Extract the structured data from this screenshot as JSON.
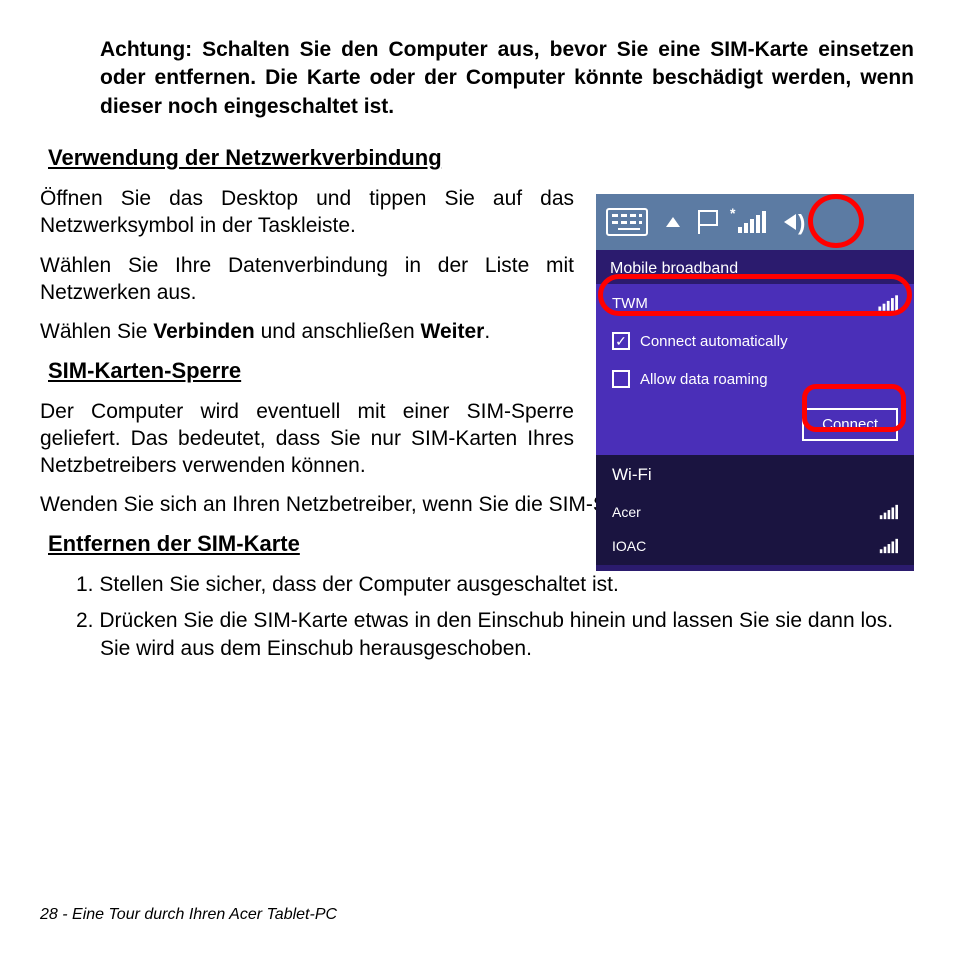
{
  "warning": "Achtung: Schalten Sie den Computer aus, bevor Sie eine SIM-Karte einsetzen oder entfernen. Die Karte oder der Computer könnte beschädigt werden, wenn dieser noch eingeschaltet ist.",
  "section1": {
    "heading": "Verwendung der Netzwerkverbindung",
    "p1": "Öffnen Sie das Desktop und tippen Sie auf das Netzwerksymbol in der Taskleiste.",
    "p2": "Wählen Sie Ihre Datenverbindung in der Liste mit Netzwerken aus.",
    "p3a": "Wählen Sie ",
    "p3b": "Verbinden",
    "p3c": " und anschließen ",
    "p3d": "Weiter",
    "p3e": "."
  },
  "section2": {
    "heading": "SIM-Karten-Sperre",
    "p1": "Der Computer wird eventuell mit einer SIM-Sperre geliefert. Das bedeutet, dass Sie nur SIM-Karten Ihres Netzbetreibers verwenden können.",
    "p2": "Wenden Sie sich an Ihren Netzbetreiber, wenn Sie die SIM-Sperre aufheben möchten."
  },
  "section3": {
    "heading": "Entfernen der SIM-Karte",
    "item1_num": "1. ",
    "item1": "Stellen Sie sicher, dass der Computer ausgeschaltet ist.",
    "item2_num": "2. ",
    "item2": "Drücken Sie die SIM-Karte etwas in den Einschub hinein und lassen Sie sie dann los. Sie wird aus dem Einschub herausgeschoben."
  },
  "footer": "28 - Eine Tour durch Ihren Acer Tablet-PC",
  "figure": {
    "mobile_broadband": "Mobile broadband",
    "network_name": "TWM",
    "connect_auto": "Connect automatically",
    "allow_roaming": "Allow data roaming",
    "connect_btn": "Connect",
    "wifi_title": "Wi-Fi",
    "wifi1": "Acer",
    "wifi2": "IOAC",
    "checkmark": "✓"
  }
}
